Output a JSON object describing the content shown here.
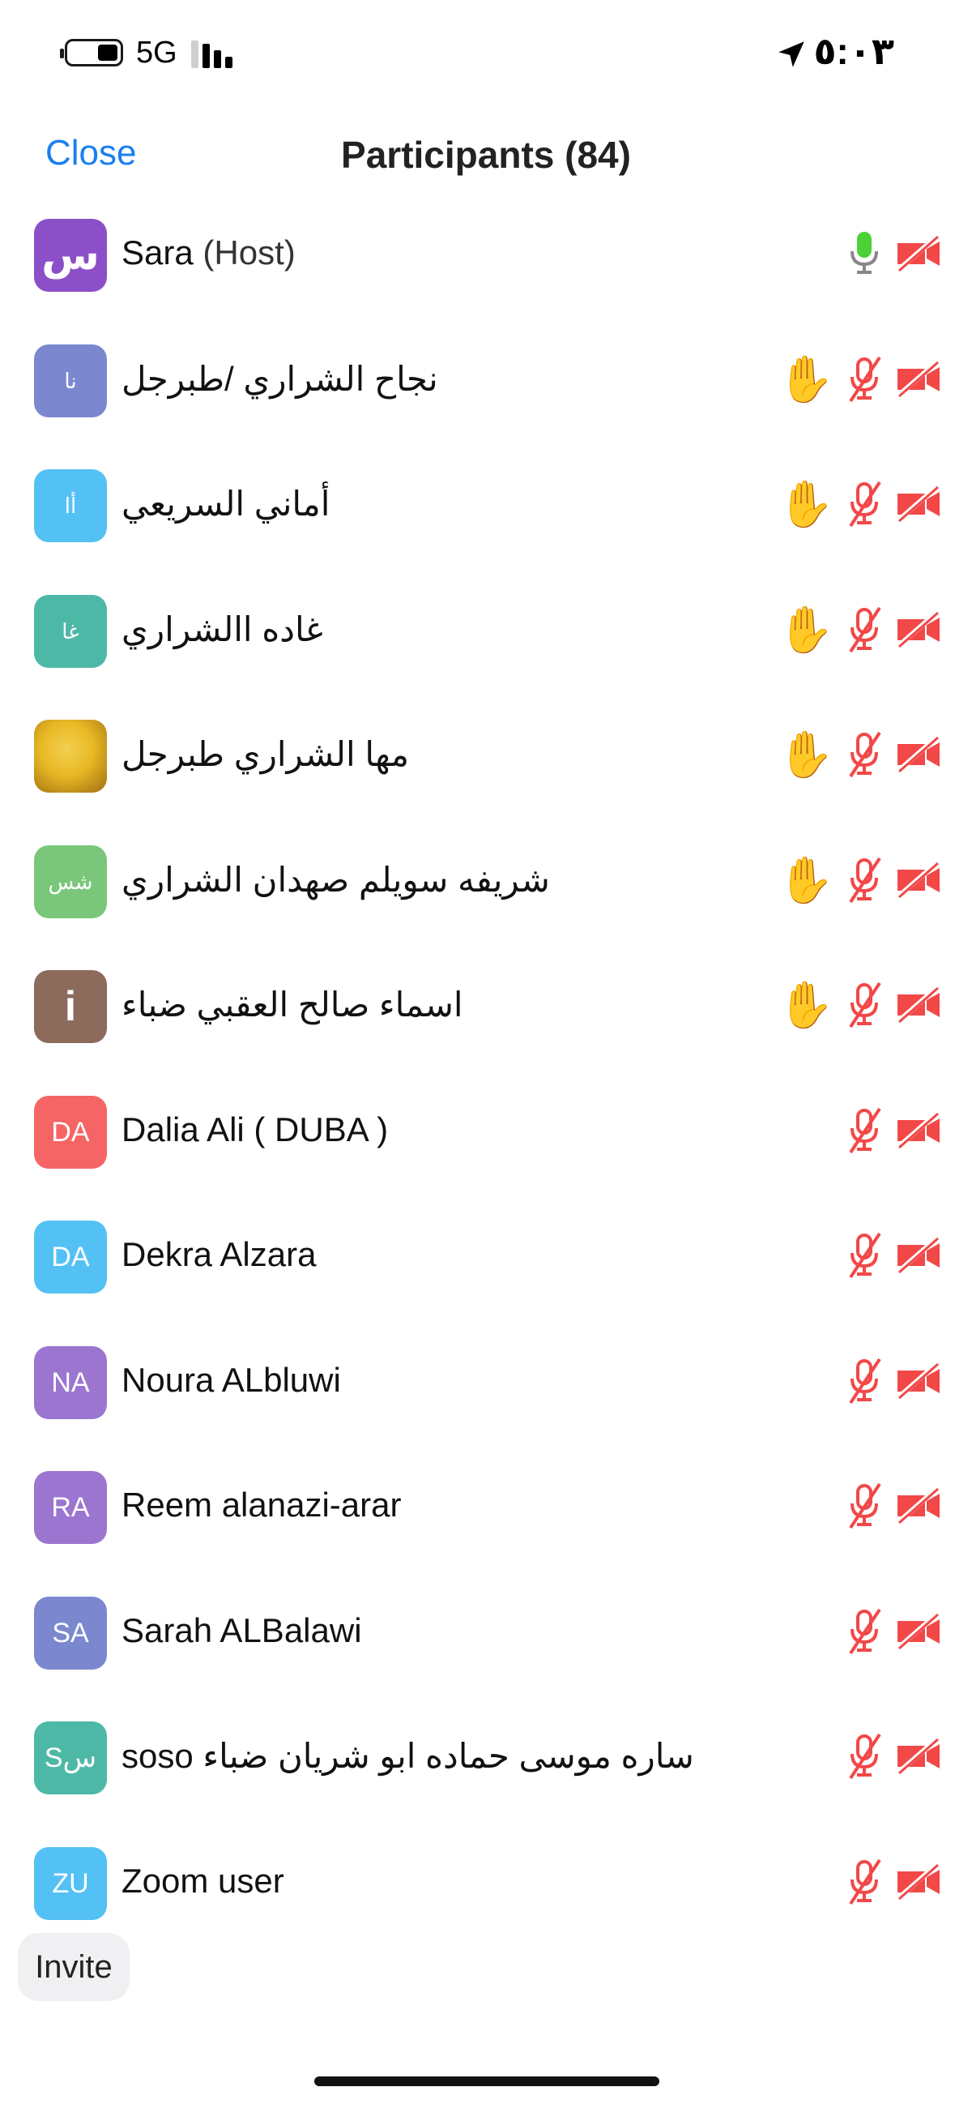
{
  "status_bar": {
    "network": "5G",
    "time": "٥:٠٣"
  },
  "header": {
    "close_label": "Close",
    "title": "Participants (84)"
  },
  "participants": [
    {
      "initials": "س",
      "name": "Sara",
      "suffix": " (Host)",
      "avatar_color": "#8b4fc8",
      "hand_raised": false,
      "mic": "on",
      "video": "off"
    },
    {
      "initials": "نا",
      "name": "نجاح الشراري /طبرجل",
      "avatar_color": "#7b88cf",
      "hand_raised": true,
      "mic": "muted",
      "video": "off"
    },
    {
      "initials": "أا",
      "name": "أماني السريعي",
      "avatar_color": "#54c1f5",
      "hand_raised": true,
      "mic": "muted",
      "video": "off"
    },
    {
      "initials": "غا",
      "name": "غاده االشراري",
      "avatar_color": "#4eb8a7",
      "hand_raised": true,
      "mic": "muted",
      "video": "off"
    },
    {
      "initials": "",
      "name": "مها الشراري طبرجل",
      "avatar_color": "#e8b824",
      "hand_raised": true,
      "mic": "muted",
      "video": "off"
    },
    {
      "initials": "شس",
      "name": "شريفه سويلم صهدان الشراري",
      "avatar_color": "#7ac77b",
      "hand_raised": true,
      "mic": "muted",
      "video": "off"
    },
    {
      "initials": "i",
      "name": "اسماء صالح العقبي ضباء",
      "avatar_color": "#8c6a5c",
      "hand_raised": true,
      "mic": "muted",
      "video": "off"
    },
    {
      "initials": "DA",
      "name": "Dalia Ali ( DUBA )",
      "avatar_color": "#f66565",
      "hand_raised": false,
      "mic": "muted",
      "video": "off"
    },
    {
      "initials": "DA",
      "name": "Dekra Alzara",
      "avatar_color": "#54c1f5",
      "hand_raised": false,
      "mic": "muted",
      "video": "off"
    },
    {
      "initials": "NA",
      "name": "Noura ALbluwi",
      "avatar_color": "#9b75d0",
      "hand_raised": false,
      "mic": "muted",
      "video": "off"
    },
    {
      "initials": "RA",
      "name": "Reem alanazi-arar",
      "avatar_color": "#9b75d0",
      "hand_raised": false,
      "mic": "muted",
      "video": "off"
    },
    {
      "initials": "SA",
      "name": "Sarah ALBalawi",
      "avatar_color": "#7b88cf",
      "hand_raised": false,
      "mic": "muted",
      "video": "off"
    },
    {
      "initials": "Sس",
      "name": "soso   ساره موسى حماده ابو شريان ضباء",
      "avatar_color": "#4eb8a7",
      "hand_raised": false,
      "mic": "muted",
      "video": "off"
    },
    {
      "initials": "ZU",
      "name": "Zoom user",
      "avatar_color": "#54c1f5",
      "hand_raised": false,
      "mic": "muted",
      "video": "off"
    }
  ],
  "invite_label": "Invite",
  "icons": {
    "raised_hand": "raised-hand-icon",
    "mic_on": "microphone-icon",
    "mic_muted": "microphone-muted-icon",
    "video_off": "video-off-icon"
  },
  "colors": {
    "accent": "#1a7ff0",
    "muted_red": "#f24848",
    "mic_green": "#4cd137"
  }
}
